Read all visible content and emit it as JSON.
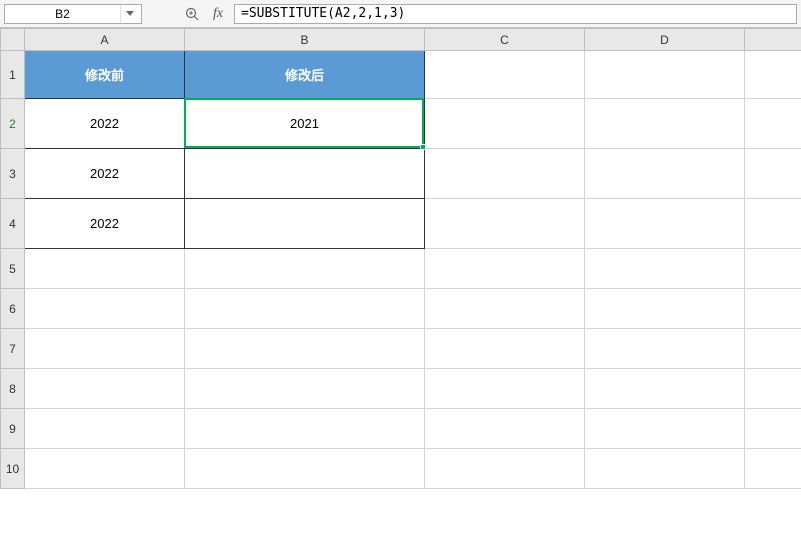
{
  "namebox": {
    "value": "B2"
  },
  "formula": {
    "value": "=SUBSTITUTE(A2,2,1,3)"
  },
  "columns": {
    "A": "A",
    "B": "B",
    "C": "C",
    "D": "D"
  },
  "rows": {
    "1": "1",
    "2": "2",
    "3": "3",
    "4": "4",
    "5": "5",
    "6": "6",
    "7": "7",
    "8": "8",
    "9": "9",
    "10": "10"
  },
  "headers": {
    "A1": "修改前",
    "B1": "修改后"
  },
  "cells": {
    "A2": "2022",
    "A3": "2022",
    "A4": "2022",
    "B2": "2021"
  },
  "active": {
    "cell": "B2"
  }
}
